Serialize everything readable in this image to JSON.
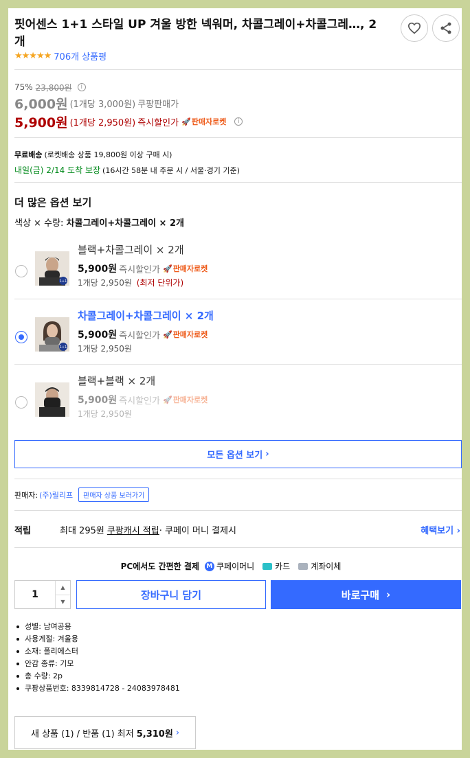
{
  "product": {
    "title": "핏어센스 1+1 스타일 UP 겨울 방한 넥워머, 차콜그레이+차콜그레…, 2개",
    "stars": "★★★★★",
    "review_count": "706개 상품평"
  },
  "price": {
    "discount_rate": "75%",
    "original_price": "23,800원",
    "coupang_price": "6,000원",
    "coupang_unit": "(1개당 3,000원)",
    "coupang_label": "쿠팡판매가",
    "instant_price": "5,900원",
    "instant_unit": "(1개당 2,950원)",
    "instant_label": "즉시할인가",
    "rocket_label": "판매자로켓"
  },
  "shipping": {
    "free_label": "무료배송",
    "free_condition": "(로켓배송 상품 19,800원 이상 구매 시)",
    "arrival": "내일(금) 2/14 도착 보장",
    "arrival_note": "(16시간 58분  내 주문 시 / 서울·경기 기준)"
  },
  "options_section": {
    "title": "더 많은 옵션 보기",
    "summary_prefix": "색상 × 수량:",
    "summary_value": "차콜그레이+차콜그레이 × 2개",
    "items": [
      {
        "name": "블랙+차콜그레이 × 2개",
        "price": "5,900원",
        "price_label": "즉시할인가",
        "rocket": "판매자로켓",
        "unit": "1개당 2,950원",
        "lowest": "(최저 단위가)"
      },
      {
        "name": "차콜그레이+차콜그레이 × 2개",
        "price": "5,900원",
        "price_label": "즉시할인가",
        "rocket": "판매자로켓",
        "unit": "1개당 2,950원"
      },
      {
        "name": "블랙+블랙 × 2개",
        "price": "5,900원",
        "price_label": "즉시할인가",
        "rocket": "판매자로켓",
        "unit": "1개당 2,950원"
      }
    ],
    "all_options": "모든 옵션 보기"
  },
  "seller": {
    "label": "판매자:",
    "name": "(주)릴리프",
    "products_link": "판매자 상품 보러가기"
  },
  "accumulate": {
    "label": "적립",
    "text1": "최대 295원",
    "text2": "쿠팡캐시 적립",
    "text3": " · 쿠페이 머니 결제시",
    "benefit": "혜택보기"
  },
  "payment": {
    "title": "PC에서도 간편한 결제",
    "methods": [
      "쿠페이머니",
      "카드",
      "계좌이체"
    ]
  },
  "purchase": {
    "quantity": "1",
    "cart": "장바구니 담기",
    "buy": "바로구매"
  },
  "specs": [
    "성별: 남여공용",
    "사용계절: 겨울용",
    "소재: 폴리에스터",
    "안감 종류: 기모",
    "총 수량: 2p",
    "쿠팡상품번호: 8339814728 - 24083978481"
  ],
  "new_used": {
    "text": "새 상품 (1) / 반품 (1) 최저",
    "price": "5,310원"
  }
}
